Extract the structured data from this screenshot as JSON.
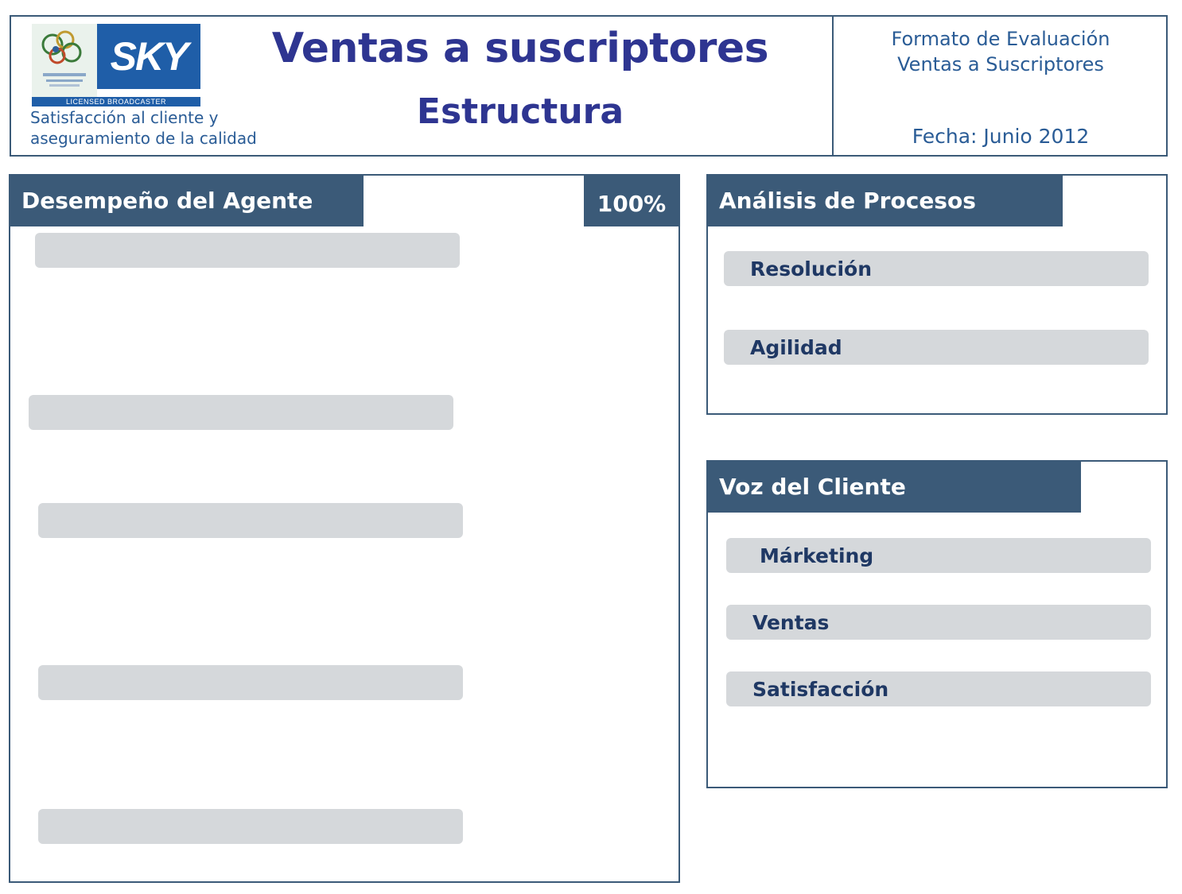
{
  "header": {
    "logo": {
      "brand": "SKY",
      "band_text": "LICENSED BROADCASTER",
      "icon": "world-cup-emblem-icon"
    },
    "subtitle_left": [
      "Satisfacción al cliente y",
      "aseguramiento de la calidad"
    ],
    "title": "Ventas a suscriptores",
    "subtitle": "Estructura",
    "format_title": [
      "Formato de Evaluación",
      "Ventas a Suscriptores"
    ],
    "date": "Fecha: Junio 2012"
  },
  "agent_panel": {
    "title": "Desempeño del Agente",
    "percentage": "100%",
    "items": [
      "",
      "",
      "",
      "",
      ""
    ]
  },
  "process_panel": {
    "title": "Análisis de Procesos",
    "items": [
      "Resolución",
      "Agilidad"
    ]
  },
  "voice_panel": {
    "title": "Voz del Cliente",
    "items": [
      "Márketing",
      "Ventas",
      "Satisfacción"
    ]
  },
  "colors": {
    "panel_header": "#3b5a78",
    "title_text": "#2e3591",
    "accent_text": "#2a5c96",
    "bar_fill": "#d5d8db",
    "bar_text": "#1f3864",
    "sky_blue": "#1f5ea8"
  }
}
